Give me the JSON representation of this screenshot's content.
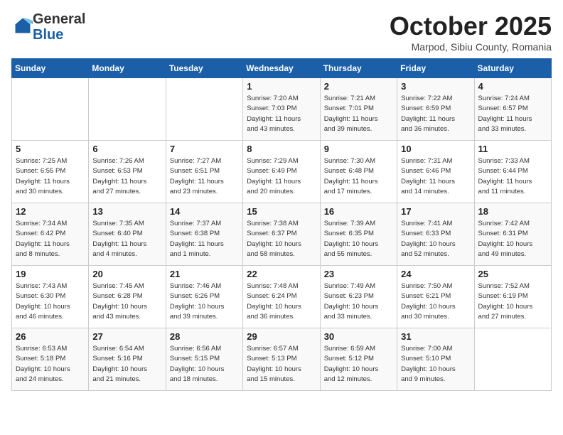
{
  "header": {
    "logo_line1": "General",
    "logo_line2": "Blue",
    "month": "October 2025",
    "location": "Marpod, Sibiu County, Romania"
  },
  "weekdays": [
    "Sunday",
    "Monday",
    "Tuesday",
    "Wednesday",
    "Thursday",
    "Friday",
    "Saturday"
  ],
  "weeks": [
    [
      {
        "day": "",
        "info": ""
      },
      {
        "day": "",
        "info": ""
      },
      {
        "day": "",
        "info": ""
      },
      {
        "day": "1",
        "info": "Sunrise: 7:20 AM\nSunset: 7:03 PM\nDaylight: 11 hours\nand 43 minutes."
      },
      {
        "day": "2",
        "info": "Sunrise: 7:21 AM\nSunset: 7:01 PM\nDaylight: 11 hours\nand 39 minutes."
      },
      {
        "day": "3",
        "info": "Sunrise: 7:22 AM\nSunset: 6:59 PM\nDaylight: 11 hours\nand 36 minutes."
      },
      {
        "day": "4",
        "info": "Sunrise: 7:24 AM\nSunset: 6:57 PM\nDaylight: 11 hours\nand 33 minutes."
      }
    ],
    [
      {
        "day": "5",
        "info": "Sunrise: 7:25 AM\nSunset: 6:55 PM\nDaylight: 11 hours\nand 30 minutes."
      },
      {
        "day": "6",
        "info": "Sunrise: 7:26 AM\nSunset: 6:53 PM\nDaylight: 11 hours\nand 27 minutes."
      },
      {
        "day": "7",
        "info": "Sunrise: 7:27 AM\nSunset: 6:51 PM\nDaylight: 11 hours\nand 23 minutes."
      },
      {
        "day": "8",
        "info": "Sunrise: 7:29 AM\nSunset: 6:49 PM\nDaylight: 11 hours\nand 20 minutes."
      },
      {
        "day": "9",
        "info": "Sunrise: 7:30 AM\nSunset: 6:48 PM\nDaylight: 11 hours\nand 17 minutes."
      },
      {
        "day": "10",
        "info": "Sunrise: 7:31 AM\nSunset: 6:46 PM\nDaylight: 11 hours\nand 14 minutes."
      },
      {
        "day": "11",
        "info": "Sunrise: 7:33 AM\nSunset: 6:44 PM\nDaylight: 11 hours\nand 11 minutes."
      }
    ],
    [
      {
        "day": "12",
        "info": "Sunrise: 7:34 AM\nSunset: 6:42 PM\nDaylight: 11 hours\nand 8 minutes."
      },
      {
        "day": "13",
        "info": "Sunrise: 7:35 AM\nSunset: 6:40 PM\nDaylight: 11 hours\nand 4 minutes."
      },
      {
        "day": "14",
        "info": "Sunrise: 7:37 AM\nSunset: 6:38 PM\nDaylight: 11 hours\nand 1 minute."
      },
      {
        "day": "15",
        "info": "Sunrise: 7:38 AM\nSunset: 6:37 PM\nDaylight: 10 hours\nand 58 minutes."
      },
      {
        "day": "16",
        "info": "Sunrise: 7:39 AM\nSunset: 6:35 PM\nDaylight: 10 hours\nand 55 minutes."
      },
      {
        "day": "17",
        "info": "Sunrise: 7:41 AM\nSunset: 6:33 PM\nDaylight: 10 hours\nand 52 minutes."
      },
      {
        "day": "18",
        "info": "Sunrise: 7:42 AM\nSunset: 6:31 PM\nDaylight: 10 hours\nand 49 minutes."
      }
    ],
    [
      {
        "day": "19",
        "info": "Sunrise: 7:43 AM\nSunset: 6:30 PM\nDaylight: 10 hours\nand 46 minutes."
      },
      {
        "day": "20",
        "info": "Sunrise: 7:45 AM\nSunset: 6:28 PM\nDaylight: 10 hours\nand 43 minutes."
      },
      {
        "day": "21",
        "info": "Sunrise: 7:46 AM\nSunset: 6:26 PM\nDaylight: 10 hours\nand 39 minutes."
      },
      {
        "day": "22",
        "info": "Sunrise: 7:48 AM\nSunset: 6:24 PM\nDaylight: 10 hours\nand 36 minutes."
      },
      {
        "day": "23",
        "info": "Sunrise: 7:49 AM\nSunset: 6:23 PM\nDaylight: 10 hours\nand 33 minutes."
      },
      {
        "day": "24",
        "info": "Sunrise: 7:50 AM\nSunset: 6:21 PM\nDaylight: 10 hours\nand 30 minutes."
      },
      {
        "day": "25",
        "info": "Sunrise: 7:52 AM\nSunset: 6:19 PM\nDaylight: 10 hours\nand 27 minutes."
      }
    ],
    [
      {
        "day": "26",
        "info": "Sunrise: 6:53 AM\nSunset: 5:18 PM\nDaylight: 10 hours\nand 24 minutes."
      },
      {
        "day": "27",
        "info": "Sunrise: 6:54 AM\nSunset: 5:16 PM\nDaylight: 10 hours\nand 21 minutes."
      },
      {
        "day": "28",
        "info": "Sunrise: 6:56 AM\nSunset: 5:15 PM\nDaylight: 10 hours\nand 18 minutes."
      },
      {
        "day": "29",
        "info": "Sunrise: 6:57 AM\nSunset: 5:13 PM\nDaylight: 10 hours\nand 15 minutes."
      },
      {
        "day": "30",
        "info": "Sunrise: 6:59 AM\nSunset: 5:12 PM\nDaylight: 10 hours\nand 12 minutes."
      },
      {
        "day": "31",
        "info": "Sunrise: 7:00 AM\nSunset: 5:10 PM\nDaylight: 10 hours\nand 9 minutes."
      },
      {
        "day": "",
        "info": ""
      }
    ]
  ]
}
